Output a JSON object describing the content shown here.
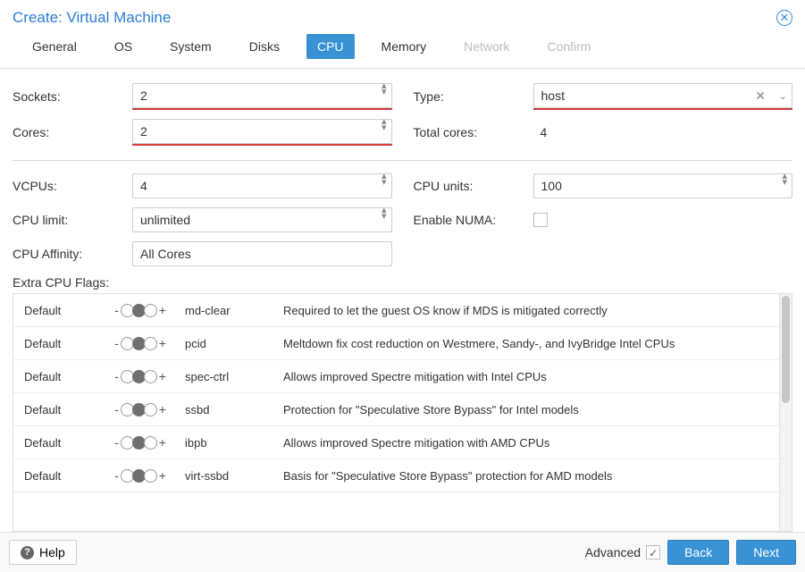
{
  "title": "Create: Virtual Machine",
  "tabs": {
    "general": "General",
    "os": "OS",
    "system": "System",
    "disks": "Disks",
    "cpu": "CPU",
    "memory": "Memory",
    "network": "Network",
    "confirm": "Confirm"
  },
  "fields": {
    "sockets": {
      "label": "Sockets:",
      "value": "2"
    },
    "cores": {
      "label": "Cores:",
      "value": "2"
    },
    "type": {
      "label": "Type:",
      "value": "host"
    },
    "total_cores": {
      "label": "Total cores:",
      "value": "4"
    },
    "vcpus": {
      "label": "VCPUs:",
      "value": "4"
    },
    "cpu_limit": {
      "label": "CPU limit:",
      "value": "unlimited"
    },
    "cpu_affinity": {
      "label": "CPU Affinity:",
      "value": "All Cores"
    },
    "cpu_units": {
      "label": "CPU units:",
      "value": "100"
    },
    "enable_numa": {
      "label": "Enable NUMA:"
    }
  },
  "extra_flags_label": "Extra CPU Flags:",
  "flags": [
    {
      "state": "Default",
      "name": "md-clear",
      "desc": "Required to let the guest OS know if MDS is mitigated correctly"
    },
    {
      "state": "Default",
      "name": "pcid",
      "desc": "Meltdown fix cost reduction on Westmere, Sandy-, and IvyBridge Intel CPUs"
    },
    {
      "state": "Default",
      "name": "spec-ctrl",
      "desc": "Allows improved Spectre mitigation with Intel CPUs"
    },
    {
      "state": "Default",
      "name": "ssbd",
      "desc": "Protection for \"Speculative Store Bypass\" for Intel models"
    },
    {
      "state": "Default",
      "name": "ibpb",
      "desc": "Allows improved Spectre mitigation with AMD CPUs"
    },
    {
      "state": "Default",
      "name": "virt-ssbd",
      "desc": "Basis for \"Speculative Store Bypass\" protection for AMD models"
    }
  ],
  "footer": {
    "help": "Help",
    "advanced": "Advanced",
    "back": "Back",
    "next": "Next"
  }
}
